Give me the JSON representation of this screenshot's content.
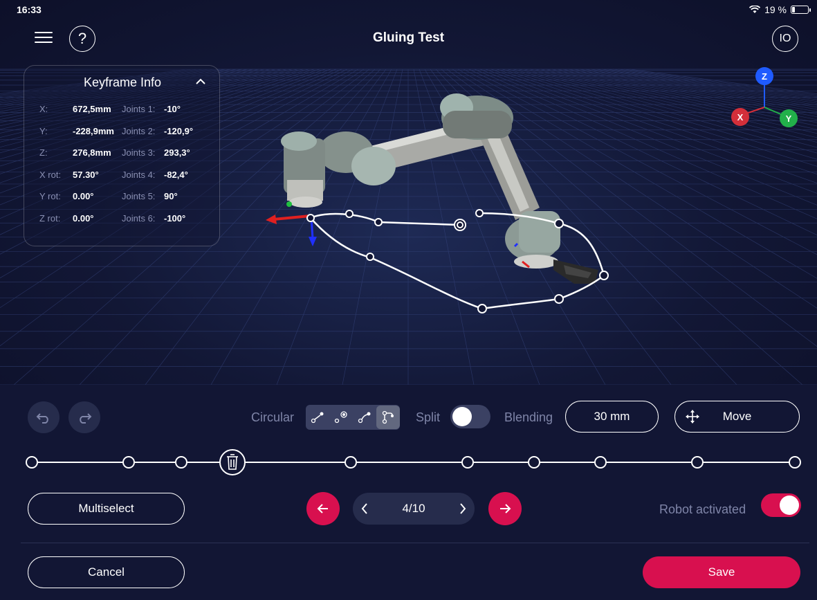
{
  "status": {
    "time": "16:33",
    "battery_text": "19 %",
    "battery_level": 0.19
  },
  "header": {
    "title": "Gluing Test",
    "io_label": "IO",
    "help_label": "?"
  },
  "keyframe": {
    "title": "Keyframe Info",
    "rows": [
      {
        "label": "X:",
        "value": "672,5mm",
        "joint_label": "Joints 1:",
        "joint_value": "-10°"
      },
      {
        "label": "Y:",
        "value": "-228,9mm",
        "joint_label": "Joints 2:",
        "joint_value": "-120,9°"
      },
      {
        "label": "Z:",
        "value": "276,8mm",
        "joint_label": "Joints 3:",
        "joint_value": "293,3°"
      },
      {
        "label": "X rot:",
        "value": "57.30°",
        "joint_label": "Joints 4:",
        "joint_value": "-82,4°"
      },
      {
        "label": "Y rot:",
        "value": "0.00°",
        "joint_label": "Joints 5:",
        "joint_value": "90°"
      },
      {
        "label": "Z rot:",
        "value": "0.00°",
        "joint_label": "Joints 6:",
        "joint_value": "-100°"
      }
    ]
  },
  "axis_gizmo": {
    "x": "X",
    "y": "Y",
    "z": "Z",
    "x_color": "#d32f3a",
    "y_color": "#22b04a",
    "z_color": "#1f5bff"
  },
  "toolbar": {
    "circular_label": "Circular",
    "split_label": "Split",
    "split_on": false,
    "blending_label": "Blending",
    "blending_value": "30 mm",
    "move_label": "Move"
  },
  "navigation": {
    "multiselect_label": "Multiselect",
    "page_indicator": "4/10",
    "robot_activated_label": "Robot activated",
    "robot_activated": true
  },
  "footer": {
    "cancel_label": "Cancel",
    "save_label": "Save"
  },
  "colors": {
    "accent": "#d8104f",
    "background": "#121634",
    "control": "#262c4c"
  }
}
